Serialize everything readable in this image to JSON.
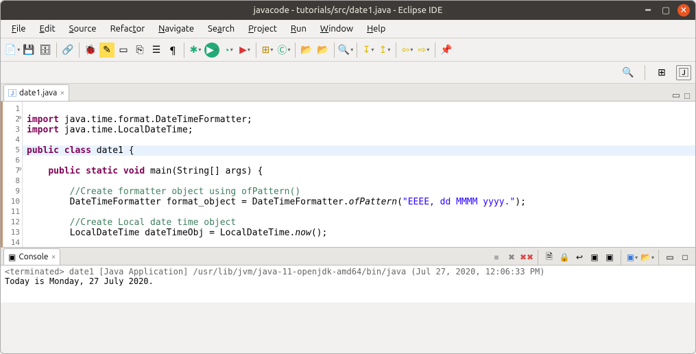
{
  "window": {
    "title": "javacode - tutorials/src/date1.java - Eclipse IDE"
  },
  "menubar": {
    "items": [
      "File",
      "Edit",
      "Source",
      "Refactor",
      "Navigate",
      "Search",
      "Project",
      "Run",
      "Window",
      "Help"
    ]
  },
  "editor": {
    "tab_label": "date1.java",
    "tab_close": "×",
    "lines": {
      "l1": "",
      "l2": {
        "kw": "import",
        "rest": " java.time.format.DateTimeFormatter;"
      },
      "l3": {
        "kw": "import",
        "rest": " java.time.LocalDateTime;"
      },
      "l4": "",
      "l5": {
        "pre": "public class",
        "name": " date1 {",
        "kw2": ""
      },
      "l6": "",
      "l7": {
        "pre": "    ",
        "kw": "public static void",
        "rest": " main(String[] args) {"
      },
      "l8": "",
      "l9": {
        "cm": "        //Create formatter object using ofPattern()"
      },
      "l10": {
        "pre": "        DateTimeFormatter format_object = DateTimeFormatter.",
        "fn": "ofPattern",
        "post": "(",
        "str": "\"EEEE, dd MMMM yyyy.\"",
        "end": ");"
      },
      "l11": "",
      "l12": {
        "cm": "        //Create Local date time object"
      },
      "l13": {
        "pre": "        LocalDateTime dateTimeObj = LocalDateTime.",
        "fn": "now",
        "post": "();"
      },
      "l14": ""
    }
  },
  "console": {
    "tab_label": "Console",
    "tab_close": "×",
    "header": "<terminated> date1 [Java Application] /usr/lib/jvm/java-11-openjdk-amd64/bin/java (Jul 27, 2020, 12:06:33 PM)",
    "output": "Today is Monday, 27 July 2020."
  },
  "icons": {
    "new": "📄",
    "save": "💾",
    "undo": "↶",
    "debug": "🐞",
    "run": "▶",
    "search_big": "🔍",
    "open_persp": "▤",
    "java_persp": "☕"
  }
}
